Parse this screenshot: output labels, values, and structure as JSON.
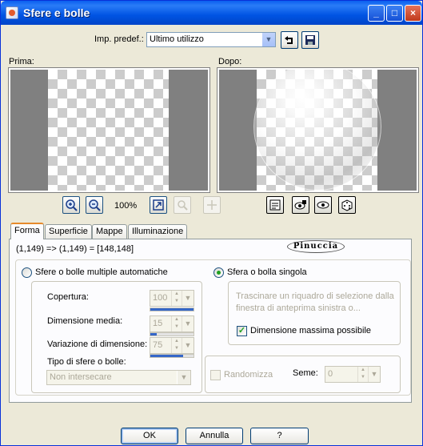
{
  "window": {
    "title": "Sfere e bolle"
  },
  "titlebar_buttons": {
    "minimize": "_",
    "maximize": "□",
    "close": "×"
  },
  "presets": {
    "label": "Imp. predef.:",
    "value": "Ultimo utilizzo"
  },
  "preview": {
    "before_label": "Prima:",
    "after_label": "Dopo:",
    "zoom": "100%"
  },
  "tabs": [
    "Forma",
    "Superficie",
    "Mappe",
    "Illuminazione"
  ],
  "active_tab": "Forma",
  "coords_text": "(1,149) => (1,149) = [148,148]",
  "logo_text": "Pinuccia",
  "auto_mode": {
    "label": "Sfere o bolle multiple automatiche",
    "selected": false,
    "coverage": {
      "label": "Copertura:",
      "value": "100",
      "fraction": 1.0
    },
    "avg_size": {
      "label": "Dimensione media:",
      "value": "15",
      "fraction": 0.15
    },
    "size_variation": {
      "label": "Variazione di dimensione:",
      "value": "75",
      "fraction": 0.75
    },
    "type": {
      "label": "Tipo di sfere o bolle:",
      "value": "Non intersecare"
    },
    "randomize": {
      "label": "Randomizza",
      "checked": false
    },
    "seed": {
      "label": "Seme:",
      "value": "0"
    }
  },
  "single_mode": {
    "label": "Sfera o bolla singola",
    "selected": true,
    "note": "Trascinare un riquadro di selezione dalla finestra di anteprima sinistra o...",
    "max_size": {
      "label": "Dimensione massima possibile",
      "checked": true
    }
  },
  "buttons": {
    "ok": "OK",
    "cancel": "Annulla",
    "help": "?"
  },
  "colors": {
    "titlebar": "#0054e3",
    "active_tab_accent": "#e68b2c",
    "dialog_bg": "#ece9d8"
  }
}
